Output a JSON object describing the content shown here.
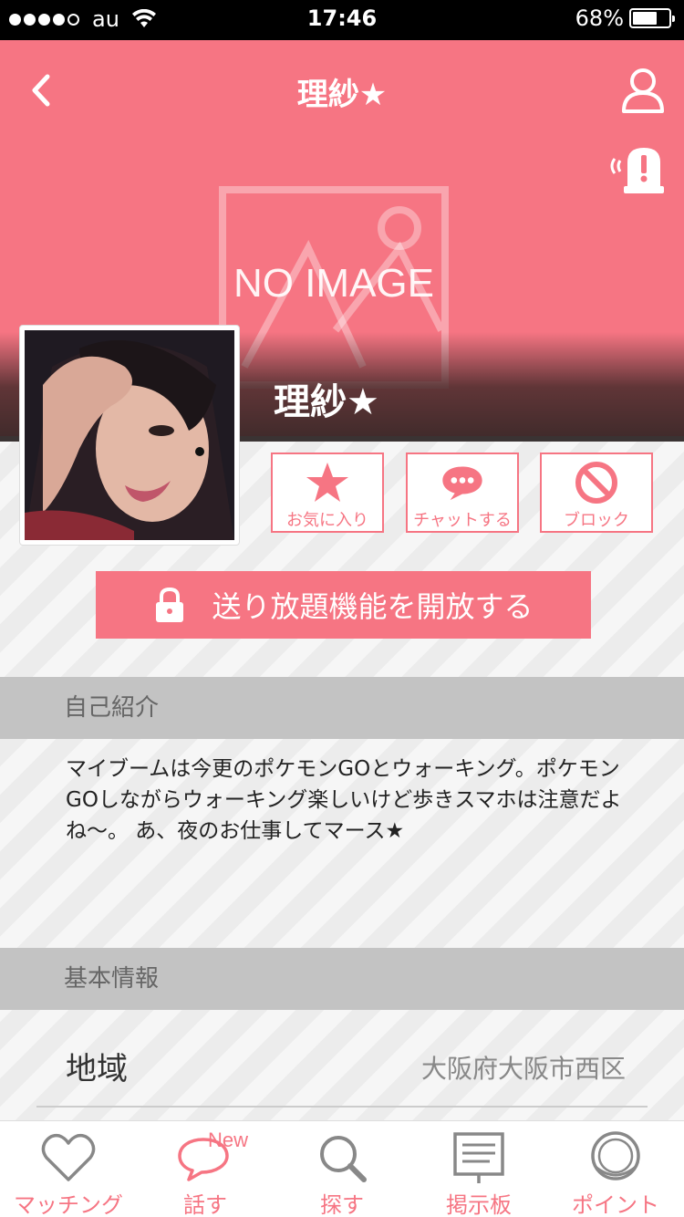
{
  "status_bar": {
    "carrier": "au",
    "time": "17:46",
    "battery": "68%",
    "battery_level": 0.68,
    "signal_bars": 4
  },
  "header": {
    "title": "理紗★",
    "back_icon": "chevron-left-icon",
    "user_icon": "user-icon",
    "report_icon": "alert-siren-icon"
  },
  "cover": {
    "placeholder_text": "NO IMAGE"
  },
  "profile": {
    "name": "理紗★"
  },
  "actions": {
    "favorite_label": "お気に入り",
    "chat_label": "チャットする",
    "block_label": "ブロック"
  },
  "unlock": {
    "label": "送り放題機能を開放する",
    "icon": "lock-icon"
  },
  "intro": {
    "heading": "自己紹介",
    "text": "マイブームは今更のポケモンGOとウォーキング。ポケモンGOしながらウォーキング楽しいけど歩きスマホは注意だよね〜。 あ、夜のお仕事してマース★"
  },
  "basic": {
    "heading": "基本情報",
    "rows": [
      {
        "label": "地域",
        "value": "大阪府大阪市西区"
      }
    ]
  },
  "tabbar": {
    "tabs": [
      {
        "label": "マッチング",
        "icon": "heart-icon"
      },
      {
        "label": "話す",
        "icon": "speech-bubble-icon",
        "badge": "New"
      },
      {
        "label": "探す",
        "icon": "search-icon"
      },
      {
        "label": "掲示板",
        "icon": "board-icon"
      },
      {
        "label": "ポイント",
        "icon": "coin-icon"
      }
    ]
  },
  "colors": {
    "accent": "#f67583",
    "section_bg": "#c3c3c3"
  }
}
